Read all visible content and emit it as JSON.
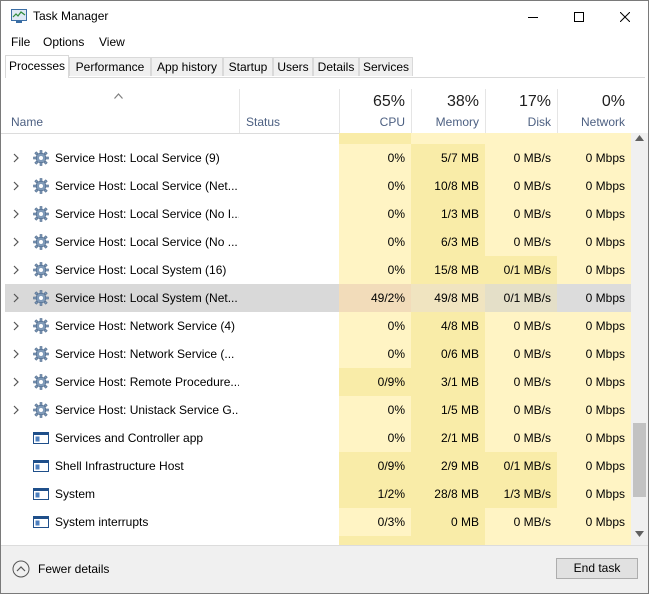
{
  "window": {
    "title": "Task Manager"
  },
  "menu": [
    "File",
    "Options",
    "View"
  ],
  "tabs": [
    "Processes",
    "Performance",
    "App history",
    "Startup",
    "Users",
    "Details",
    "Services"
  ],
  "active_tab": "Processes",
  "columns": {
    "name": "Name",
    "status": "Status",
    "cpu": {
      "percent": "65%",
      "label": "CPU"
    },
    "memory": {
      "percent": "38%",
      "label": "Memory"
    },
    "disk": {
      "percent": "17%",
      "label": "Disk"
    },
    "network": {
      "percent": "0%",
      "label": "Network"
    }
  },
  "rows": [
    {
      "name": "Service Host: Local Service (9)",
      "expandable": true,
      "icon": "gear-icon",
      "cpu": "0%",
      "memory": "5/7 MB",
      "disk": "0 MB/s",
      "network": "0 Mbps"
    },
    {
      "name": "Service Host: Local Service (Net...",
      "expandable": true,
      "icon": "gear-icon",
      "cpu": "0%",
      "memory": "10/8 MB",
      "disk": "0 MB/s",
      "network": "0 Mbps"
    },
    {
      "name": "Service Host: Local Service (No I...",
      "expandable": true,
      "icon": "gear-icon",
      "cpu": "0%",
      "memory": "1/3 MB",
      "disk": "0 MB/s",
      "network": "0 Mbps"
    },
    {
      "name": "Service Host: Local Service (No ...",
      "expandable": true,
      "icon": "gear-icon",
      "cpu": "0%",
      "memory": "6/3 MB",
      "disk": "0 MB/s",
      "network": "0 Mbps"
    },
    {
      "name": "Service Host: Local System (16)",
      "expandable": true,
      "icon": "gear-icon",
      "cpu": "0%",
      "memory": "15/8 MB",
      "disk": "0/1 MB/s",
      "network": "0 Mbps"
    },
    {
      "name": "Service Host: Local System (Net...",
      "expandable": true,
      "icon": "gear-icon",
      "cpu": "49/2%",
      "memory": "49/8 MB",
      "disk": "0/1 MB/s",
      "network": "0 Mbps",
      "selected": true
    },
    {
      "name": "Service Host: Network Service (4)",
      "expandable": true,
      "icon": "gear-icon",
      "cpu": "0%",
      "memory": "4/8 MB",
      "disk": "0 MB/s",
      "network": "0 Mbps"
    },
    {
      "name": "Service Host: Network Service (...",
      "expandable": true,
      "icon": "gear-icon",
      "cpu": "0%",
      "memory": "0/6 MB",
      "disk": "0 MB/s",
      "network": "0 Mbps"
    },
    {
      "name": "Service Host: Remote Procedure...",
      "expandable": true,
      "icon": "gear-icon",
      "cpu": "0/9%",
      "memory": "3/1 MB",
      "disk": "0 MB/s",
      "network": "0 Mbps"
    },
    {
      "name": "Service Host: Unistack Service G...",
      "expandable": true,
      "icon": "gear-icon",
      "cpu": "0%",
      "memory": "1/5 MB",
      "disk": "0 MB/s",
      "network": "0 Mbps"
    },
    {
      "name": "Services and Controller app",
      "expandable": false,
      "icon": "app-window-icon",
      "cpu": "0%",
      "memory": "2/1 MB",
      "disk": "0 MB/s",
      "network": "0 Mbps"
    },
    {
      "name": "Shell Infrastructure Host",
      "expandable": false,
      "icon": "app-window-icon",
      "cpu": "0/9%",
      "memory": "2/9 MB",
      "disk": "0/1 MB/s",
      "network": "0 Mbps"
    },
    {
      "name": "System",
      "expandable": false,
      "icon": "app-window-icon",
      "cpu": "1/2%",
      "memory": "28/8 MB",
      "disk": "1/3 MB/s",
      "network": "0 Mbps"
    },
    {
      "name": "System interrupts",
      "expandable": false,
      "icon": "app-window-icon",
      "cpu": "0/3%",
      "memory": "0 MB",
      "disk": "0 MB/s",
      "network": "0 Mbps"
    }
  ],
  "footer": {
    "fewer_details": "Fewer details",
    "end_task": "End task"
  },
  "colors": {
    "heat_light": "#fff4c4",
    "heat_mid": "#f9eca8",
    "selected": "#d9d9d9",
    "header_label": "#4d6082"
  }
}
